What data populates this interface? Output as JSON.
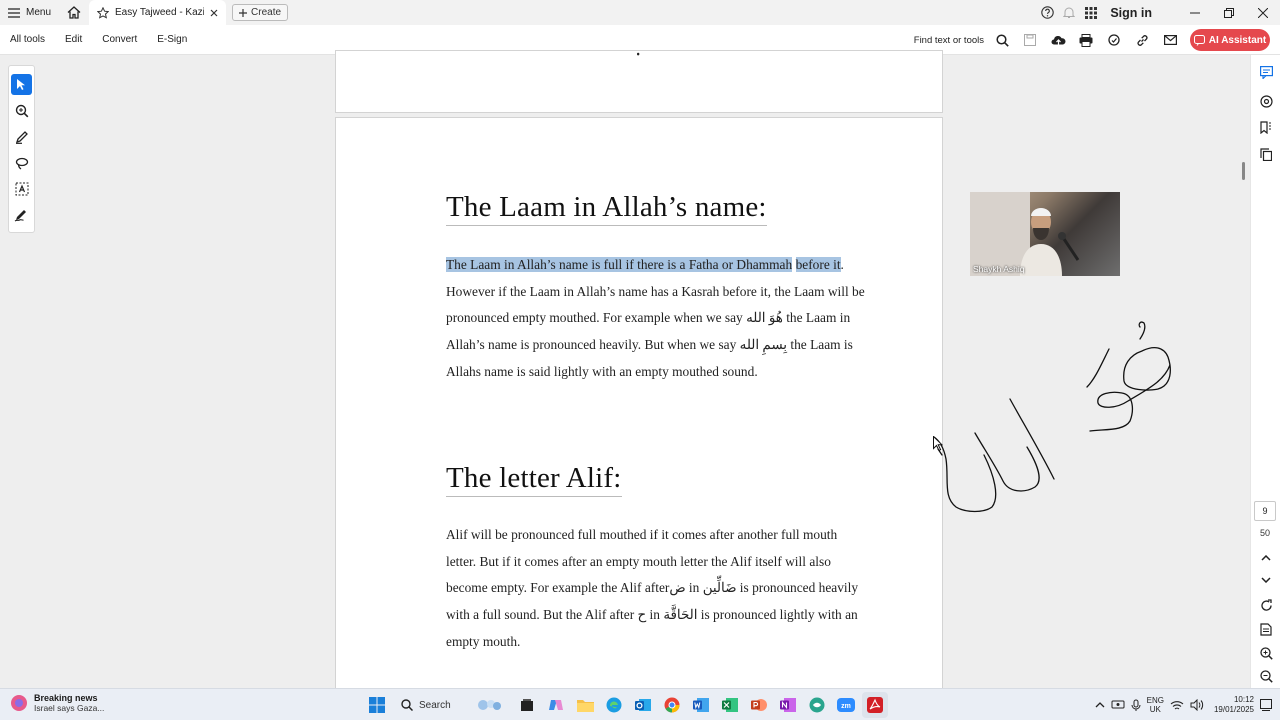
{
  "titlebar": {
    "menu_label": "Menu",
    "tab_title": "Easy Tajweed - Kazi Ashi...",
    "create_label": "Create",
    "sign_in": "Sign in"
  },
  "toolbar": {
    "items": [
      "All tools",
      "Edit",
      "Convert",
      "E-Sign"
    ],
    "find_label": "Find text or tools",
    "ai_label": "AI Assistant"
  },
  "document": {
    "top_page_glyph": "ꞏ",
    "heading1": "The Laam in Allah’s name:",
    "p1_highlight_line1": "The Laam in Allah’s name is full if there is a Fatha or Dhammah",
    "p1_highlight_line2": "before it",
    "p1_rest": ". However if the Laam in Allah’s name has a Kasrah before it, the Laam will be pronounced empty mouthed. For example when we say ",
    "p1_arabic1": "هُوَ الله",
    "p1_mid": " the Laam in Allah’s name is pronounced heavily. But when we say ",
    "p1_arabic2": "بِسمِ الله",
    "p1_end": " the Laam is Allahs name is said lightly with an empty mouthed sound.",
    "heading2": "The letter Alif:",
    "p2_a": "Alif will be pronounced full mouthed if it comes after another full mouth letter. But if it comes after an empty mouth letter the Alif itself will also become empty.  For example the Alif after",
    "p2_ar1": "ض",
    "p2_b": " in ",
    "p2_ar2": "ضَالِّين",
    "p2_c": " is pronounced heavily with a full sound. But the Alif after ",
    "p2_ar3": "ح",
    "p2_d": " in ",
    "p2_ar4": "الحَاقَّة",
    "p2_e": " is pronounced lightly with an empty mouth."
  },
  "video": {
    "name": "Shaykh Ashiq"
  },
  "page_nav": {
    "current_page": "9",
    "total_pages": "50"
  },
  "taskbar": {
    "news_title": "Breaking news",
    "news_sub": "Israel says Gaza...",
    "search_label": "Search",
    "lang1": "ENG",
    "lang2": "UK",
    "time": "10:12",
    "date": "19/01/2025"
  },
  "colors": {
    "accent_blue": "#1473e6",
    "highlight": "#a7c4e2",
    "ai_button": "#e5484d"
  }
}
